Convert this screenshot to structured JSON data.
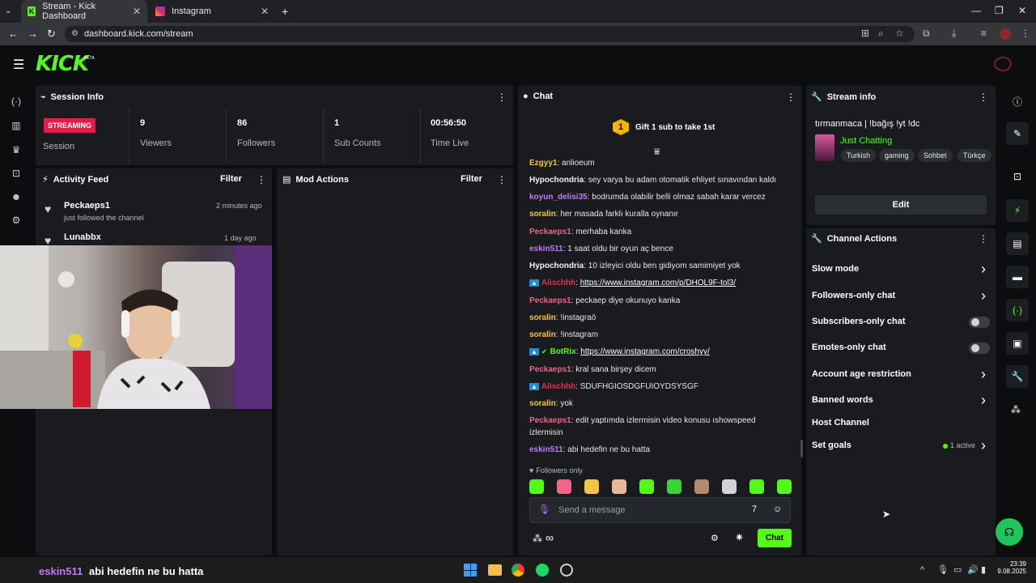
{
  "browser": {
    "tabs": [
      {
        "title": "Stream - Kick Dashboard",
        "active": true
      },
      {
        "title": "Instagram",
        "active": false
      }
    ],
    "url": "dashboard.kick.com/stream"
  },
  "header": {
    "logo": "KICK",
    "badge": "BETA"
  },
  "session": {
    "title": "Session Info",
    "status": "STREAMING",
    "status_label": "Session",
    "stats": [
      {
        "value": "9",
        "label": "Viewers"
      },
      {
        "value": "86",
        "label": "Followers"
      },
      {
        "value": "1",
        "label": "Sub Counts"
      },
      {
        "value": "00:56:50",
        "label": "Time Live"
      }
    ]
  },
  "activity": {
    "title": "Activity Feed",
    "filter": "Filter",
    "items": [
      {
        "user": "Peckaeps1",
        "action": "just followed the channel",
        "time": "2 minutes ago"
      },
      {
        "user": "Lunabbx",
        "action": "",
        "time": "1 day ago"
      }
    ]
  },
  "mod": {
    "title": "Mod Actions",
    "filter": "Filter"
  },
  "chat": {
    "title": "Chat",
    "gift_badge": "1",
    "gift_text": "Gift 1 sub to take 1st",
    "messages": [
      {
        "user": "Ezgyy1",
        "color": "#f5c542",
        "text": "anlioeum",
        "link": false
      },
      {
        "user": "Hypochondria",
        "color": "#f0f0f0",
        "text": "sey varya bu adam otomatik ehliyet sınavından kaldı",
        "link": false
      },
      {
        "user": "koyun_delisi35",
        "color": "#c07cf6",
        "text": "bodrumda olabilir belli olmaz sabah karar vercez",
        "link": false
      },
      {
        "user": "soralin",
        "color": "#f5c542",
        "text": "her masada farklı kuralla oynanır",
        "link": false
      },
      {
        "user": "Peckaeps1",
        "color": "#f5628a",
        "text": "merhaba kanka",
        "link": false
      },
      {
        "user": "eskin511",
        "color": "#c07cf6",
        "text": "1 saat oldu bir oyun aç bence",
        "link": false
      },
      {
        "user": "Hypochondria",
        "color": "#f0f0f0",
        "text": "10 izleyici oldu ben gidiyom samimiyet yok",
        "link": false
      },
      {
        "user": "Alischhh",
        "color": "#e0334f",
        "text": "https://www.instagram.com/p/DHOL9F-tol3/",
        "link": true
      },
      {
        "user": "Peckaeps1",
        "color": "#f5628a",
        "text": "peckaep diye okunuyo kanka",
        "link": false
      },
      {
        "user": "soralin",
        "color": "#f5c542",
        "text": "!instagraö",
        "link": false
      },
      {
        "user": "soralin",
        "color": "#f5c542",
        "text": "!instagram",
        "link": false
      },
      {
        "user": "BotRix",
        "color": "#53fc18",
        "text": "https://www.instagram.com/croshyy/",
        "link": true
      },
      {
        "user": "Peckaeps1",
        "color": "#f5628a",
        "text": "kral sana birşey dicem",
        "link": false
      },
      {
        "user": "Alischhh",
        "color": "#e0334f",
        "text": "SDUFHGIOSDGFUIOYDSYSGF",
        "link": false
      },
      {
        "user": "soralin",
        "color": "#f5c542",
        "text": "yok",
        "link": false
      },
      {
        "user": "Peckaeps1",
        "color": "#f5628a",
        "text": "edit yaptımda izlermisin video konusu ıshowspeed",
        "link": false
      },
      {
        "user": "",
        "color": "#e6e8ea",
        "text": "izlermisin",
        "link": false
      },
      {
        "user": "eskin511",
        "color": "#c07cf6",
        "text": "abi hedefin ne bu hatta",
        "link": false
      }
    ],
    "followers_only": "Followers only",
    "placeholder": "Send a message",
    "send": "Chat",
    "emote_colors": [
      "#53fc18",
      "#f5628a",
      "#f5c542",
      "#e8b89a",
      "#53fc18",
      "#3ad43a",
      "#b08a6a",
      "#cfd3d6",
      "#53fc18",
      "#53fc18"
    ]
  },
  "streaminfo": {
    "title": "Stream info",
    "stream_title": "tırmanmaca | !bağış !yt !dc",
    "category": "Just Chatting",
    "tags": [
      "Turkish",
      "gaming",
      "Sohbet",
      "Türkçe"
    ],
    "edit": "Edit"
  },
  "channel_actions": {
    "title": "Channel Actions",
    "items": [
      {
        "label": "Slow mode",
        "kind": "chevron"
      },
      {
        "label": "Followers-only chat",
        "kind": "chevron"
      },
      {
        "label": "Subscribers-only chat",
        "kind": "toggle"
      },
      {
        "label": "Emotes-only chat",
        "kind": "toggle"
      },
      {
        "label": "Account age restriction",
        "kind": "chevron"
      },
      {
        "label": "Banned words",
        "kind": "chevron"
      },
      {
        "label": "Host Channel",
        "kind": "none"
      },
      {
        "label": "Set goals",
        "kind": "chevron",
        "extra": "1 active"
      }
    ]
  },
  "overlay": {
    "user": "eskin511",
    "text": "abi hedefin ne bu hatta"
  },
  "taskbar": {
    "time": "23:39",
    "date": "9.08.2025"
  },
  "colors": {
    "kick_green": "#53fc18",
    "streaming_red": "#e21e48",
    "panel": "#191b1f"
  }
}
